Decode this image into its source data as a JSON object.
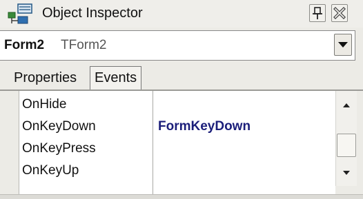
{
  "window": {
    "title": "Object Inspector",
    "icons": {
      "app": "object-inspector-icon",
      "pin": "pin-icon",
      "close": "close-icon"
    }
  },
  "selector": {
    "component_name": "Form2",
    "component_type": "TForm2",
    "icon": "chevron-down-icon"
  },
  "tabs": [
    {
      "label": "Properties",
      "active": false
    },
    {
      "label": "Events",
      "active": true
    }
  ],
  "events": [
    {
      "name": "OnHide",
      "value": ""
    },
    {
      "name": "OnKeyDown",
      "value": "FormKeyDown"
    },
    {
      "name": "OnKeyPress",
      "value": ""
    },
    {
      "name": "OnKeyUp",
      "value": ""
    }
  ],
  "colors": {
    "window_bg": "#ecebe6",
    "grid_bg": "#ffffff",
    "handler_text": "#1b1e7a"
  }
}
